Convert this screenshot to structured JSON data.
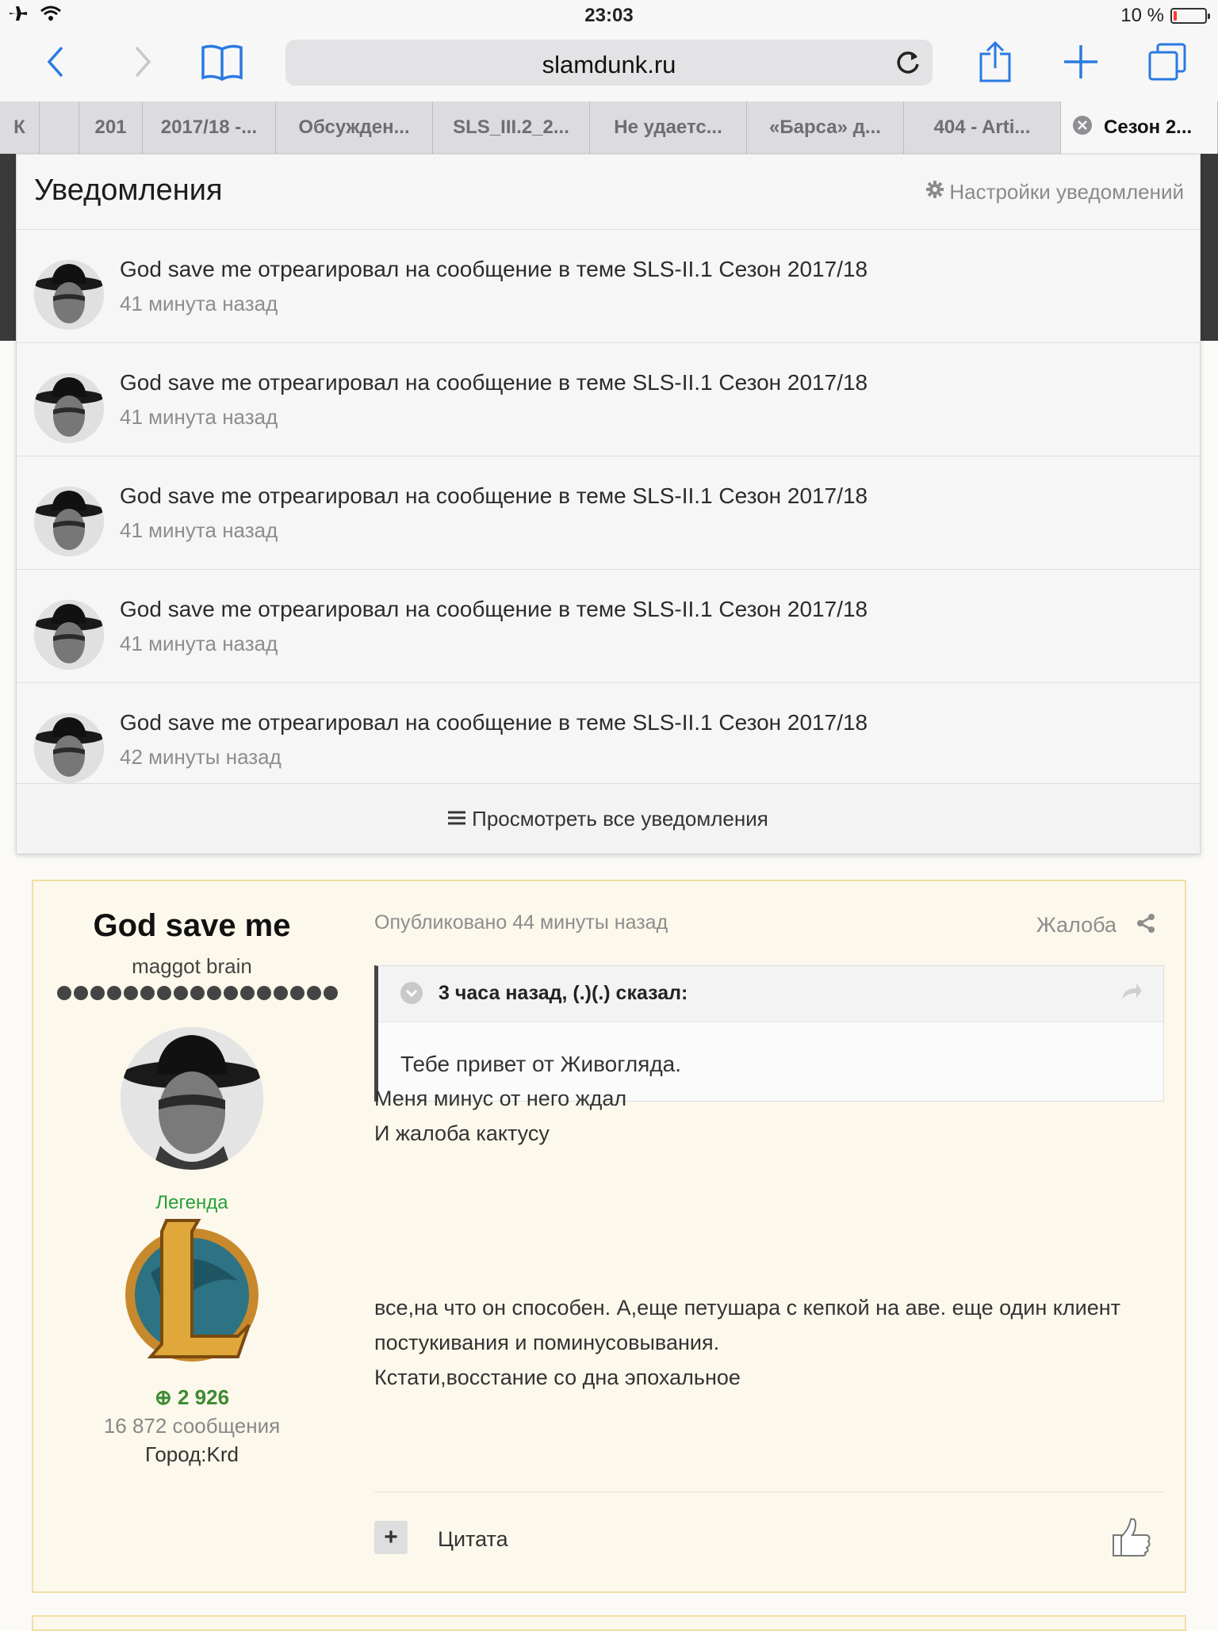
{
  "status": {
    "time": "23:03",
    "battery": "10 %",
    "battery_level_percent": 10
  },
  "browser": {
    "url": "slamdunk.ru"
  },
  "tabs": [
    {
      "label": "К",
      "width": 50
    },
    {
      "label": "",
      "width": 50
    },
    {
      "label": "201",
      "width": 80
    },
    {
      "label": "2017/18 -...",
      "width": 168
    },
    {
      "label": "Обсужден...",
      "width": 198
    },
    {
      "label": "SLS_III.2_2...",
      "width": 198
    },
    {
      "label": "Не удаетс...",
      "width": 198
    },
    {
      "label": "«Барса» д...",
      "width": 198
    },
    {
      "label": "404 - Arti...",
      "width": 198
    },
    {
      "label": "Сезон 2...",
      "width": 198,
      "active": true
    }
  ],
  "notifications": {
    "title": "Уведомления",
    "settings_label": "Настройки уведомлений",
    "items": [
      {
        "text": "God save me отреагировал на сообщение в теме SLS-II.1 Сезон 2017/18",
        "time": "41 минута назад"
      },
      {
        "text": "God save me отреагировал на сообщение в теме SLS-II.1 Сезон 2017/18",
        "time": "41 минута назад"
      },
      {
        "text": "God save me отреагировал на сообщение в теме SLS-II.1 Сезон 2017/18",
        "time": "41 минута назад"
      },
      {
        "text": "God save me отреагировал на сообщение в теме SLS-II.1 Сезон 2017/18",
        "time": "41 минута назад"
      },
      {
        "text": "God save me отреагировал на сообщение в теме SLS-II.1 Сезон 2017/18",
        "time": "42 минуты назад"
      }
    ],
    "view_all": "Просмотреть все уведомления"
  },
  "post": {
    "author": "God save me",
    "author_title": "maggot brain",
    "rank": "Легенда",
    "reputation": "2 926",
    "messages": "16 872 сообщения",
    "city": "Город:Krd",
    "posted": "Опубликовано 44 минуты назад",
    "report": "Жалоба",
    "quote_cite": "3 часа назад, (.)(.) сказал:",
    "quote_text": "Тебе привет от Живогляда.",
    "body_lines_1": [
      "Меня минус от него ждал",
      "И жалоба кактусу"
    ],
    "body_lines_2": [
      "все,на что он способен. А,еще петушара с кепкой на аве. еще один клиент",
      "постукивания и поминусовывания.",
      "Кстати,восстание со дна эпохальное"
    ],
    "quote_button": "Цитата"
  },
  "colors": {
    "accent": "#2a7ae2",
    "rank_green": "#27a035",
    "post_border": "#f0dfa6",
    "post_bg": "#fcf8ec"
  }
}
